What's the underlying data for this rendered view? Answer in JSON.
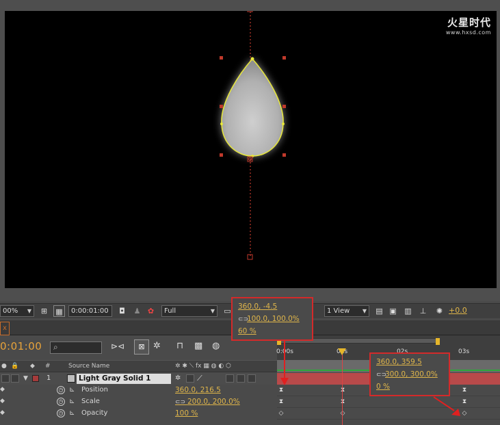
{
  "logo": {
    "title": "火星时代",
    "url": "www.hxsd.com"
  },
  "viewer_toolbar": {
    "zoom": "00%",
    "current_time": "0:00:01:00",
    "resolution": "Full",
    "views": "1 View",
    "exposure": "+0.0"
  },
  "timeline": {
    "timecode": "0:01:00",
    "search_placeholder": "",
    "headers": {
      "number": "#",
      "source_name": "Source Name"
    },
    "ruler": [
      "0:00s",
      "01s",
      "02s",
      "03s"
    ],
    "layer": {
      "number": "1",
      "name": "Light Gray Solid 1"
    },
    "properties": [
      {
        "name": "Position",
        "value": "360.0, 216.5"
      },
      {
        "name": "Scale",
        "value": "200.0, 200.0%"
      },
      {
        "name": "Opacity",
        "value": "100 %"
      }
    ]
  },
  "callout_left": {
    "position": "360.0, -4.5",
    "scale": "100.0, 100.0%",
    "opacity": "60 %"
  },
  "callout_right": {
    "position": "360.0, 359.5",
    "scale": "300.0, 300.0%",
    "opacity": "0 %"
  },
  "colors": {
    "accent": "#e0b64a",
    "callout_border": "#d42a2a",
    "layer_bar": "#b84a4a",
    "path": "#e8e83a"
  }
}
